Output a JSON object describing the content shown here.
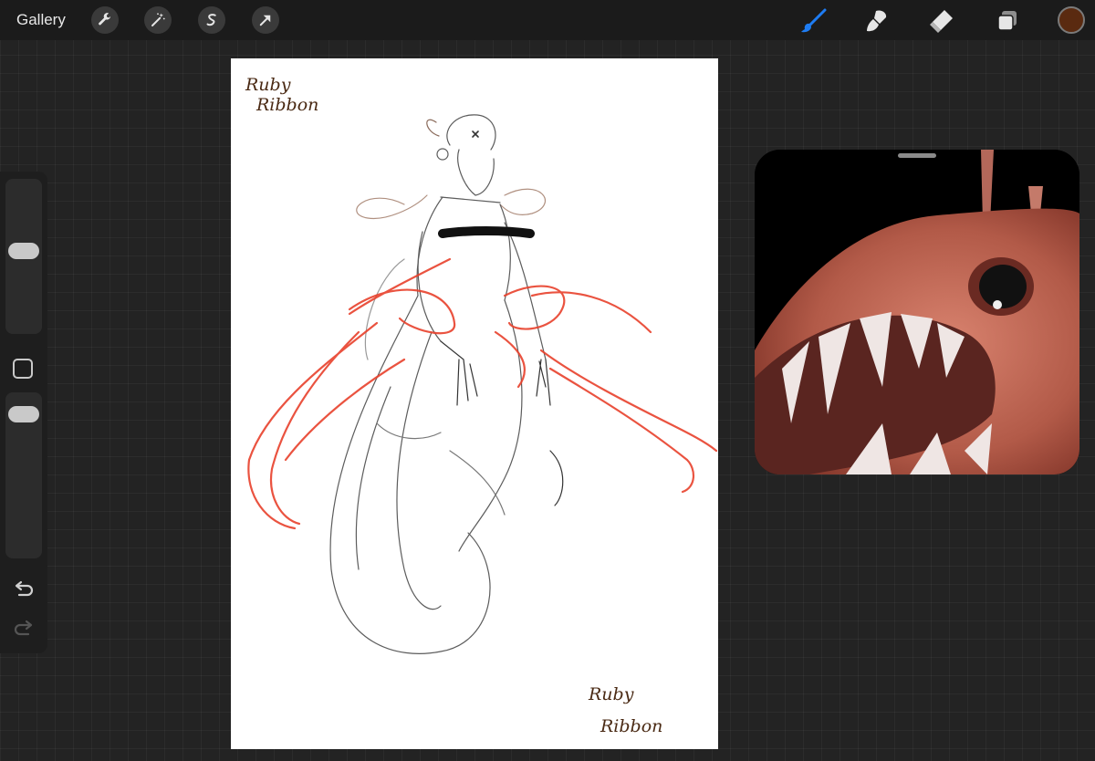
{
  "topbar": {
    "gallery_label": "Gallery",
    "left_tools": [
      {
        "icon": "wrench-icon",
        "name": "actions"
      },
      {
        "icon": "magic-wand-icon",
        "name": "adjustments"
      },
      {
        "icon": "selection-s-icon",
        "name": "selection"
      },
      {
        "icon": "arrow-cursor-icon",
        "name": "transform"
      }
    ],
    "right_tools": [
      {
        "icon": "brush-icon",
        "name": "paint",
        "active": true
      },
      {
        "icon": "smudge-icon",
        "name": "smudge"
      },
      {
        "icon": "eraser-icon",
        "name": "eraser"
      },
      {
        "icon": "layers-icon",
        "name": "layers"
      }
    ],
    "current_color": "#5a2a10",
    "active_color": "#1e7cf2"
  },
  "sidebar": {
    "brush_size_label": "",
    "opacity_label": ""
  },
  "canvas": {
    "signature_top": [
      "Ruby",
      "Ribbon"
    ],
    "signature_bottom": [
      "Ruby",
      "Ribbon"
    ],
    "signature_color": "#4a2a14",
    "ribbon_color": "#e8412c",
    "sketch_color": "#555555"
  },
  "reference": {
    "subject": "anglerfish photo"
  }
}
